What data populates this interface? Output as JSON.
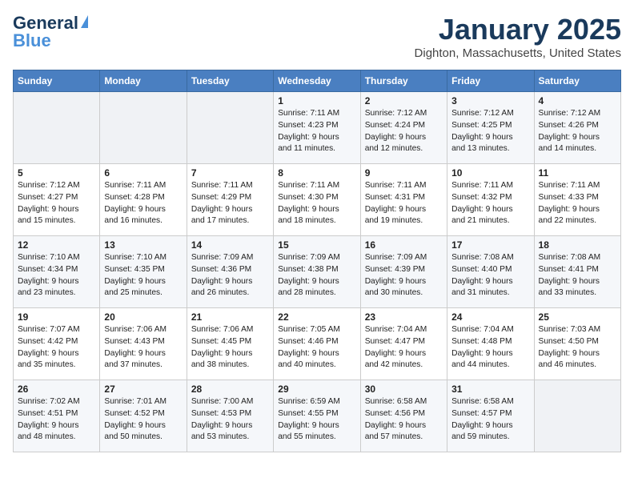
{
  "header": {
    "logo_line1": "General",
    "logo_line2": "Blue",
    "month": "January 2025",
    "location": "Dighton, Massachusetts, United States"
  },
  "days_of_week": [
    "Sunday",
    "Monday",
    "Tuesday",
    "Wednesday",
    "Thursday",
    "Friday",
    "Saturday"
  ],
  "weeks": [
    [
      {
        "day": "",
        "info": ""
      },
      {
        "day": "",
        "info": ""
      },
      {
        "day": "",
        "info": ""
      },
      {
        "day": "1",
        "info": "Sunrise: 7:11 AM\nSunset: 4:23 PM\nDaylight: 9 hours\nand 11 minutes."
      },
      {
        "day": "2",
        "info": "Sunrise: 7:12 AM\nSunset: 4:24 PM\nDaylight: 9 hours\nand 12 minutes."
      },
      {
        "day": "3",
        "info": "Sunrise: 7:12 AM\nSunset: 4:25 PM\nDaylight: 9 hours\nand 13 minutes."
      },
      {
        "day": "4",
        "info": "Sunrise: 7:12 AM\nSunset: 4:26 PM\nDaylight: 9 hours\nand 14 minutes."
      }
    ],
    [
      {
        "day": "5",
        "info": "Sunrise: 7:12 AM\nSunset: 4:27 PM\nDaylight: 9 hours\nand 15 minutes."
      },
      {
        "day": "6",
        "info": "Sunrise: 7:11 AM\nSunset: 4:28 PM\nDaylight: 9 hours\nand 16 minutes."
      },
      {
        "day": "7",
        "info": "Sunrise: 7:11 AM\nSunset: 4:29 PM\nDaylight: 9 hours\nand 17 minutes."
      },
      {
        "day": "8",
        "info": "Sunrise: 7:11 AM\nSunset: 4:30 PM\nDaylight: 9 hours\nand 18 minutes."
      },
      {
        "day": "9",
        "info": "Sunrise: 7:11 AM\nSunset: 4:31 PM\nDaylight: 9 hours\nand 19 minutes."
      },
      {
        "day": "10",
        "info": "Sunrise: 7:11 AM\nSunset: 4:32 PM\nDaylight: 9 hours\nand 21 minutes."
      },
      {
        "day": "11",
        "info": "Sunrise: 7:11 AM\nSunset: 4:33 PM\nDaylight: 9 hours\nand 22 minutes."
      }
    ],
    [
      {
        "day": "12",
        "info": "Sunrise: 7:10 AM\nSunset: 4:34 PM\nDaylight: 9 hours\nand 23 minutes."
      },
      {
        "day": "13",
        "info": "Sunrise: 7:10 AM\nSunset: 4:35 PM\nDaylight: 9 hours\nand 25 minutes."
      },
      {
        "day": "14",
        "info": "Sunrise: 7:09 AM\nSunset: 4:36 PM\nDaylight: 9 hours\nand 26 minutes."
      },
      {
        "day": "15",
        "info": "Sunrise: 7:09 AM\nSunset: 4:38 PM\nDaylight: 9 hours\nand 28 minutes."
      },
      {
        "day": "16",
        "info": "Sunrise: 7:09 AM\nSunset: 4:39 PM\nDaylight: 9 hours\nand 30 minutes."
      },
      {
        "day": "17",
        "info": "Sunrise: 7:08 AM\nSunset: 4:40 PM\nDaylight: 9 hours\nand 31 minutes."
      },
      {
        "day": "18",
        "info": "Sunrise: 7:08 AM\nSunset: 4:41 PM\nDaylight: 9 hours\nand 33 minutes."
      }
    ],
    [
      {
        "day": "19",
        "info": "Sunrise: 7:07 AM\nSunset: 4:42 PM\nDaylight: 9 hours\nand 35 minutes."
      },
      {
        "day": "20",
        "info": "Sunrise: 7:06 AM\nSunset: 4:43 PM\nDaylight: 9 hours\nand 37 minutes."
      },
      {
        "day": "21",
        "info": "Sunrise: 7:06 AM\nSunset: 4:45 PM\nDaylight: 9 hours\nand 38 minutes."
      },
      {
        "day": "22",
        "info": "Sunrise: 7:05 AM\nSunset: 4:46 PM\nDaylight: 9 hours\nand 40 minutes."
      },
      {
        "day": "23",
        "info": "Sunrise: 7:04 AM\nSunset: 4:47 PM\nDaylight: 9 hours\nand 42 minutes."
      },
      {
        "day": "24",
        "info": "Sunrise: 7:04 AM\nSunset: 4:48 PM\nDaylight: 9 hours\nand 44 minutes."
      },
      {
        "day": "25",
        "info": "Sunrise: 7:03 AM\nSunset: 4:50 PM\nDaylight: 9 hours\nand 46 minutes."
      }
    ],
    [
      {
        "day": "26",
        "info": "Sunrise: 7:02 AM\nSunset: 4:51 PM\nDaylight: 9 hours\nand 48 minutes."
      },
      {
        "day": "27",
        "info": "Sunrise: 7:01 AM\nSunset: 4:52 PM\nDaylight: 9 hours\nand 50 minutes."
      },
      {
        "day": "28",
        "info": "Sunrise: 7:00 AM\nSunset: 4:53 PM\nDaylight: 9 hours\nand 53 minutes."
      },
      {
        "day": "29",
        "info": "Sunrise: 6:59 AM\nSunset: 4:55 PM\nDaylight: 9 hours\nand 55 minutes."
      },
      {
        "day": "30",
        "info": "Sunrise: 6:58 AM\nSunset: 4:56 PM\nDaylight: 9 hours\nand 57 minutes."
      },
      {
        "day": "31",
        "info": "Sunrise: 6:58 AM\nSunset: 4:57 PM\nDaylight: 9 hours\nand 59 minutes."
      },
      {
        "day": "",
        "info": ""
      }
    ]
  ]
}
